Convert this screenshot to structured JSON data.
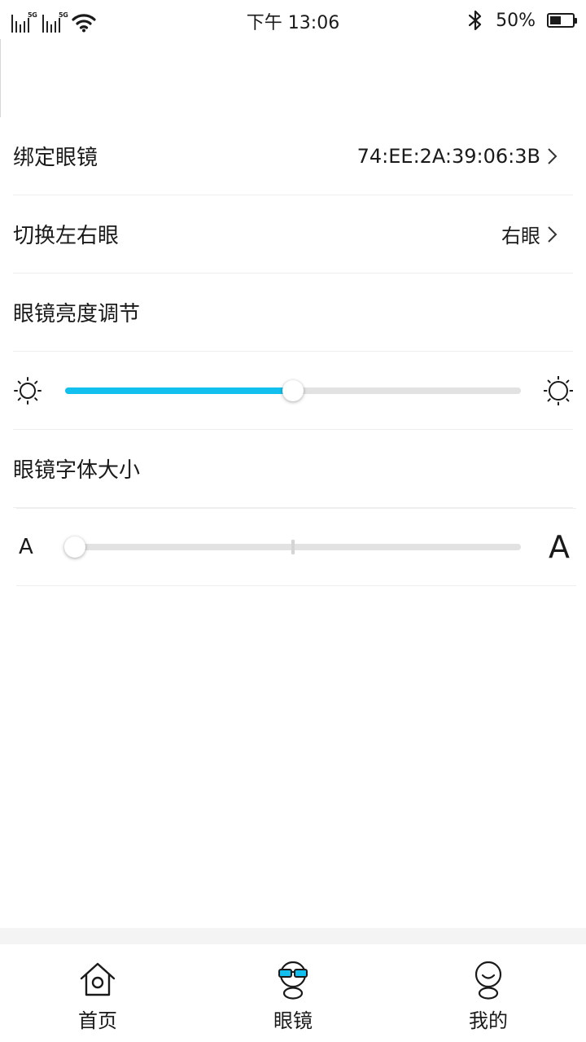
{
  "status_bar": {
    "network_1": "5G",
    "network_2": "5G",
    "time": "下午 13:06",
    "battery_percent": "50%",
    "battery_level": 0.5
  },
  "settings": {
    "bind_glasses": {
      "label": "绑定眼镜",
      "value": "74:EE:2A:39:06:3B"
    },
    "switch_eye": {
      "label": "切换左右眼",
      "value": "右眼"
    },
    "brightness": {
      "label": "眼镜亮度调节",
      "level": 0.5
    },
    "font_size": {
      "label": "眼镜字体大小",
      "small_glyph": "A",
      "large_glyph": "A",
      "level": 0,
      "steps": 3
    }
  },
  "icons": {
    "row_chevron": "chevron-right-icon",
    "brightness_low": "sun-small-icon",
    "brightness_high": "sun-large-icon"
  },
  "colors": {
    "accent": "#12c0f0",
    "track": "#e2e2e2",
    "divider": "#eeeeee"
  },
  "nav": {
    "items": [
      {
        "label": "首页",
        "icon": "home-icon",
        "active": false
      },
      {
        "label": "眼镜",
        "icon": "glasses-avatar-icon",
        "active": true
      },
      {
        "label": "我的",
        "icon": "profile-icon",
        "active": false
      }
    ]
  }
}
